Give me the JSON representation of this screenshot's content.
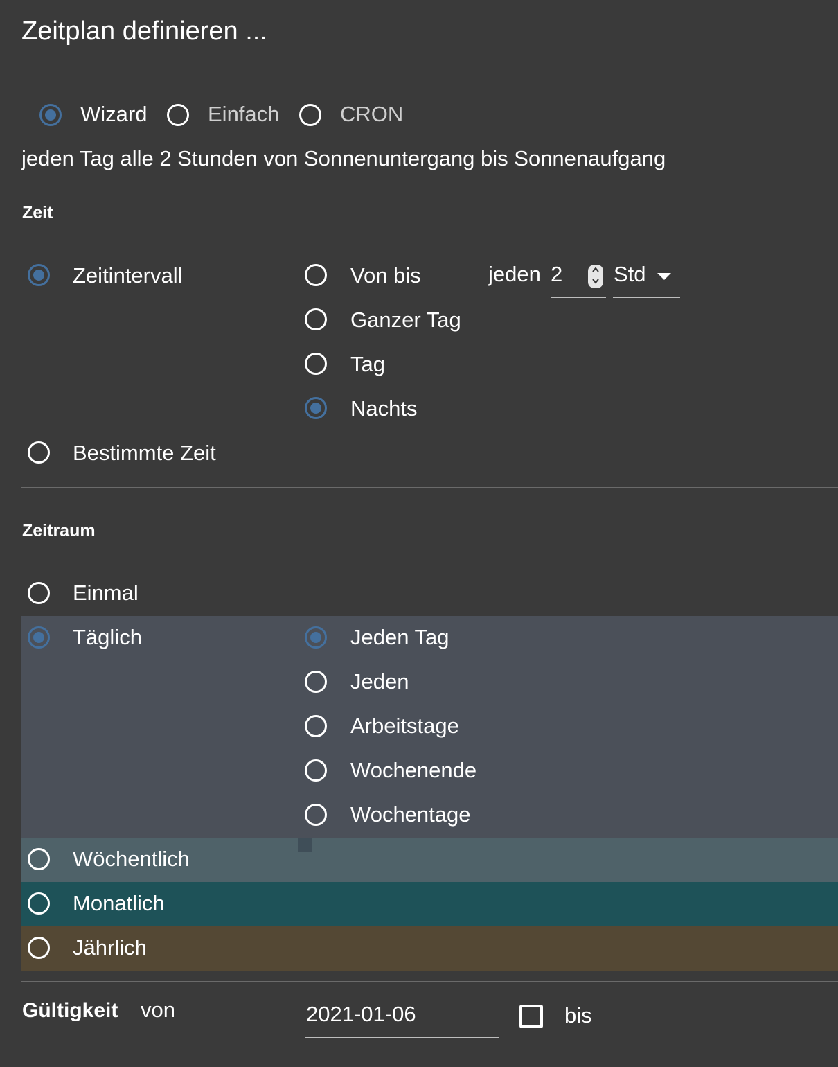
{
  "dialog": {
    "title": "Zeitplan definieren ..."
  },
  "mode": {
    "options": [
      {
        "label": "Wizard",
        "checked": true
      },
      {
        "label": "Einfach",
        "checked": false
      },
      {
        "label": "CRON",
        "checked": false
      }
    ]
  },
  "summary": "jeden Tag alle 2 Stunden von Sonnenuntergang bis Sonnenaufgang",
  "zeit": {
    "heading": "Zeit",
    "type_options": [
      {
        "label": "Zeitintervall",
        "checked": true
      },
      {
        "label": "Bestimmte Zeit",
        "checked": false
      }
    ],
    "range_options": [
      {
        "label": "Von bis",
        "checked": false
      },
      {
        "label": "Ganzer Tag",
        "checked": false
      },
      {
        "label": "Tag",
        "checked": false
      },
      {
        "label": "Nachts",
        "checked": true
      }
    ],
    "interval": {
      "prefix": "jeden",
      "value": "2",
      "unit": "Std",
      "spinner_icon": "spinner-up-down-icon",
      "dropdown_icon": "caret-down-icon"
    }
  },
  "zeitraum": {
    "heading": "Zeitraum",
    "options": [
      {
        "label": "Einmal",
        "checked": false
      },
      {
        "label": "Täglich",
        "checked": true
      },
      {
        "label": "Wöchentlich",
        "checked": false
      },
      {
        "label": "Monatlich",
        "checked": false
      },
      {
        "label": "Jährlich",
        "checked": false
      }
    ],
    "daily_options": [
      {
        "label": "Jeden Tag",
        "checked": true
      },
      {
        "label": "Jeden",
        "checked": false
      },
      {
        "label": "Arbeitstage",
        "checked": false
      },
      {
        "label": "Wochenende",
        "checked": false
      },
      {
        "label": "Wochentage",
        "checked": false
      }
    ],
    "colors": {
      "daily": "#4b5059",
      "weekly": "#4f6269",
      "monthly": "#1e5258",
      "yearly": "#544834"
    }
  },
  "validity": {
    "heading": "Gültigkeit",
    "from_label": "von",
    "from_value": "2021-01-06",
    "to_label": "bis",
    "to_enabled": false
  },
  "colors": {
    "background": "#3a3a3a",
    "accent": "#44709e",
    "text": "#ffffff"
  }
}
